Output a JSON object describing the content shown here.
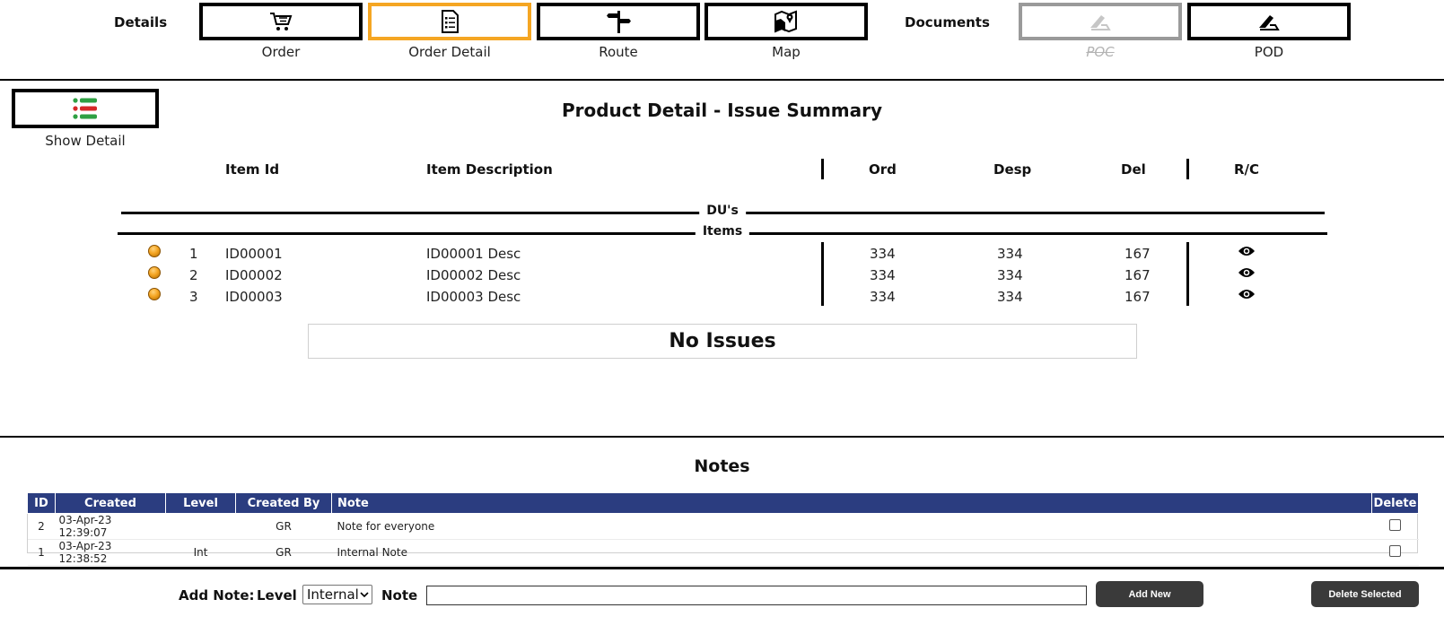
{
  "nav": {
    "details_label": "Details",
    "documents_label": "Documents",
    "buttons": [
      {
        "caption": "Order",
        "icon": "cart-icon"
      },
      {
        "caption": "Order Detail",
        "icon": "document-list-icon"
      },
      {
        "caption": "Route",
        "icon": "signpost-icon"
      },
      {
        "caption": "Map",
        "icon": "map-pin-icon"
      },
      {
        "caption": "POC",
        "icon": "scanner-icon"
      },
      {
        "caption": "POD",
        "icon": "scanner-icon"
      }
    ],
    "active_color": "#f5a623"
  },
  "show_detail": {
    "caption": "Show Detail"
  },
  "product": {
    "title": "Product Detail - Issue Summary",
    "headers": {
      "item_id": "Item Id",
      "item_desc": "Item Description",
      "ord": "Ord",
      "desp": "Desp",
      "del": "Del",
      "rc": "R/C"
    },
    "dividers": {
      "dus": "DU's",
      "items": "Items"
    },
    "rows": [
      {
        "num": "1",
        "id": "ID00001",
        "desc": "ID00001 Desc",
        "ord": "334",
        "desp": "334",
        "del": "167"
      },
      {
        "num": "2",
        "id": "ID00002",
        "desc": "ID00002 Desc",
        "ord": "334",
        "desp": "334",
        "del": "167"
      },
      {
        "num": "3",
        "id": "ID00003",
        "desc": "ID00003 Desc",
        "ord": "334",
        "desp": "334",
        "del": "167"
      }
    ],
    "issues_text": "No Issues"
  },
  "notes": {
    "title": "Notes",
    "headers": {
      "id": "ID",
      "created": "Created",
      "level": "Level",
      "created_by": "Created By",
      "note": "Note",
      "delete": "Delete"
    },
    "rows": [
      {
        "id": "2",
        "created": "03-Apr-23 12:39:07",
        "level": "",
        "created_by": "GR",
        "note": "Note for everyone"
      },
      {
        "id": "1",
        "created": "03-Apr-23 12:38:52",
        "level": "Int",
        "created_by": "GR",
        "note": "Internal Note"
      }
    ],
    "header_color": "#2b3d80"
  },
  "add_note": {
    "label": "Add Note:",
    "level_label": "Level",
    "level_value": "Internal",
    "note_label": "Note",
    "note_value": "",
    "add_button": "Add New",
    "delete_button": "Delete Selected"
  }
}
